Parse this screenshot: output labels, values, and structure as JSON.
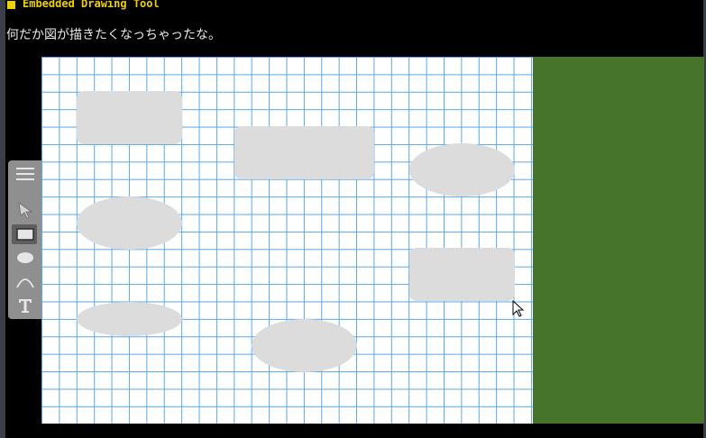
{
  "window": {
    "title": "Embedded Drawing Tool",
    "accent_color": "#f0d000"
  },
  "message": {
    "text": "何だか図が描きたくなっちゃったな。"
  },
  "canvas": {
    "background": "#ffffff",
    "grid_color": "#5aa7ee",
    "shape_fill": "#dcdcdc",
    "shapes": [
      {
        "kind": "rectangle"
      },
      {
        "kind": "rectangle"
      },
      {
        "kind": "ellipse"
      },
      {
        "kind": "ellipse"
      },
      {
        "kind": "rectangle"
      },
      {
        "kind": "ellipse"
      },
      {
        "kind": "ellipse"
      }
    ]
  },
  "side_panel": {
    "color": "#46742b"
  },
  "toolbar": {
    "tools": [
      {
        "name": "menu",
        "icon": "hamburger-menu-icon"
      },
      {
        "name": "select",
        "icon": "pointer-arrow-icon"
      },
      {
        "name": "rectangle",
        "icon": "rectangle-icon",
        "selected": true
      },
      {
        "name": "ellipse",
        "icon": "ellipse-icon"
      },
      {
        "name": "curve",
        "icon": "curve-icon"
      },
      {
        "name": "text",
        "icon": "text-icon"
      }
    ]
  }
}
